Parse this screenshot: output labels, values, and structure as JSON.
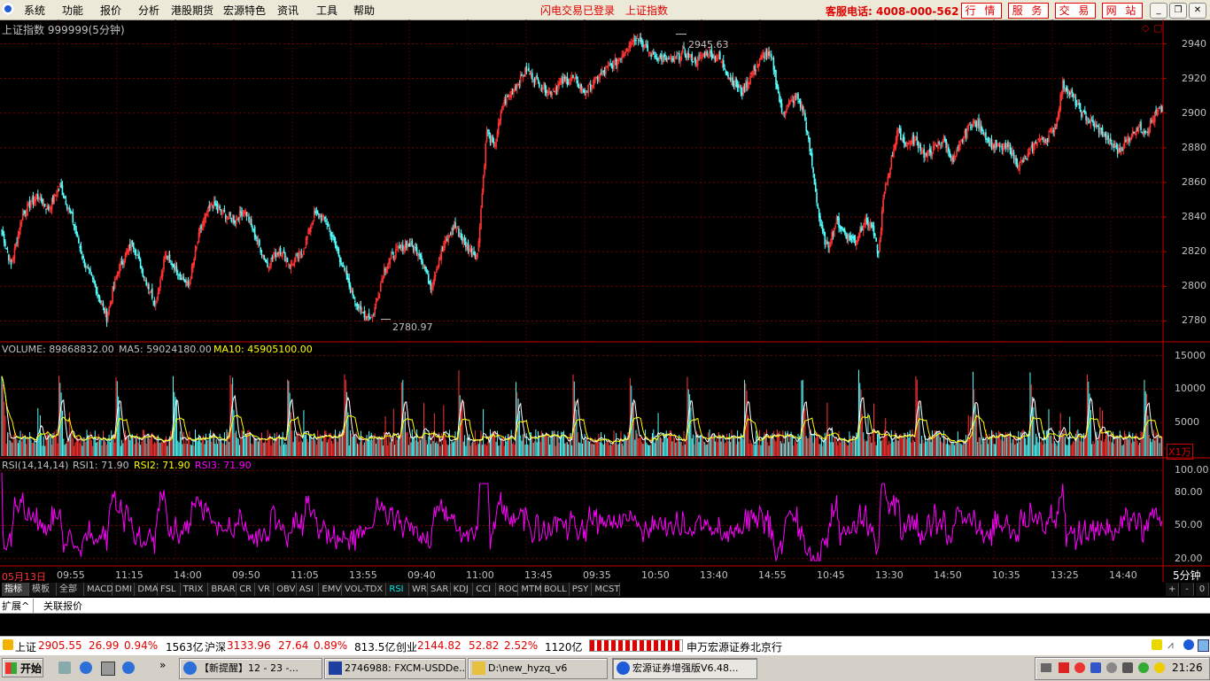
{
  "menu": [
    "系统",
    "功能",
    "报价",
    "分析",
    "港股期货",
    "宏源特色",
    "资讯",
    "工具",
    "帮助"
  ],
  "flash_left": "闪电交易已登录",
  "flash_right": "上证指数",
  "service_phone": "客服电话: 4008-000-562",
  "top_buttons": [
    "行 情",
    "服 务",
    "交 易",
    "网 站"
  ],
  "chart": {
    "title": "上证指数 999999(5分钟)",
    "high_label": "2945.63",
    "low_label": "2780.97",
    "period_label": "5分钟",
    "volume_unit": "X1万"
  },
  "volume_panel": {
    "volume": "VOLUME: 89868832.00",
    "ma5": "MA5: 59024180.00",
    "ma10": "MA10: 45905100.00"
  },
  "rsi_panel": {
    "name": "RSI(14,14,14)",
    "rsi1": "RSI1: 71.90",
    "rsi2": "RSI2: 71.90",
    "rsi3": "RSI3: 71.90"
  },
  "colors": {
    "up": "#ff3333",
    "down": "#54fcfc",
    "ma5": "#ffffff",
    "ma10": "#ffff00",
    "rsi": "#ff00ff",
    "grid": "#7a0000",
    "axis": "#c80000"
  },
  "chart_data": [
    {
      "type": "candlestick",
      "series_name": "上证指数",
      "ylim": [
        2770,
        2950
      ],
      "yticks": [
        2780,
        2800,
        2820,
        2840,
        2860,
        2880,
        2900,
        2920,
        2940
      ],
      "x_tick_labels": [
        "05月13日",
        "09:55",
        "11:15",
        "14:00",
        "09:50",
        "11:05",
        "13:55",
        "09:40",
        "11:00",
        "13:45",
        "09:35",
        "10:50",
        "13:40",
        "14:55",
        "10:45",
        "13:30",
        "14:50",
        "10:35",
        "13:25",
        "14:40"
      ],
      "keypoints": [
        [
          0,
          2832
        ],
        [
          8,
          2812
        ],
        [
          18,
          2842
        ],
        [
          30,
          2852
        ],
        [
          40,
          2845
        ],
        [
          50,
          2858
        ],
        [
          60,
          2840
        ],
        [
          70,
          2815
        ],
        [
          80,
          2800
        ],
        [
          90,
          2782
        ],
        [
          100,
          2810
        ],
        [
          112,
          2826
        ],
        [
          122,
          2806
        ],
        [
          132,
          2790
        ],
        [
          140,
          2818
        ],
        [
          150,
          2810
        ],
        [
          160,
          2800
        ],
        [
          170,
          2832
        ],
        [
          180,
          2848
        ],
        [
          190,
          2842
        ],
        [
          200,
          2838
        ],
        [
          208,
          2845
        ],
        [
          218,
          2828
        ],
        [
          228,
          2812
        ],
        [
          238,
          2822
        ],
        [
          248,
          2812
        ],
        [
          258,
          2820
        ],
        [
          268,
          2842
        ],
        [
          278,
          2838
        ],
        [
          288,
          2820
        ],
        [
          298,
          2800
        ],
        [
          308,
          2785
        ],
        [
          318,
          2782
        ],
        [
          328,
          2810
        ],
        [
          338,
          2820
        ],
        [
          348,
          2825
        ],
        [
          358,
          2820
        ],
        [
          368,
          2800
        ],
        [
          378,
          2822
        ],
        [
          388,
          2835
        ],
        [
          400,
          2822
        ],
        [
          408,
          2818
        ],
        [
          416,
          2890
        ],
        [
          422,
          2880
        ],
        [
          430,
          2905
        ],
        [
          440,
          2915
        ],
        [
          450,
          2925
        ],
        [
          460,
          2918
        ],
        [
          470,
          2912
        ],
        [
          480,
          2918
        ],
        [
          490,
          2920
        ],
        [
          500,
          2912
        ],
        [
          508,
          2918
        ],
        [
          518,
          2925
        ],
        [
          528,
          2930
        ],
        [
          538,
          2940
        ],
        [
          545,
          2945
        ],
        [
          555,
          2935
        ],
        [
          565,
          2932
        ],
        [
          575,
          2930
        ],
        [
          585,
          2935
        ],
        [
          595,
          2930
        ],
        [
          605,
          2935
        ],
        [
          615,
          2932
        ],
        [
          625,
          2920
        ],
        [
          635,
          2912
        ],
        [
          645,
          2925
        ],
        [
          655,
          2935
        ],
        [
          661,
          2930
        ],
        [
          669,
          2900
        ],
        [
          675,
          2905
        ],
        [
          682,
          2910
        ],
        [
          688,
          2900
        ],
        [
          695,
          2870
        ],
        [
          702,
          2835
        ],
        [
          708,
          2822
        ],
        [
          716,
          2838
        ],
        [
          724,
          2830
        ],
        [
          732,
          2826
        ],
        [
          740,
          2838
        ],
        [
          746,
          2835
        ],
        [
          752,
          2818
        ],
        [
          756,
          2850
        ],
        [
          762,
          2870
        ],
        [
          768,
          2890
        ],
        [
          776,
          2882
        ],
        [
          784,
          2885
        ],
        [
          792,
          2875
        ],
        [
          800,
          2880
        ],
        [
          808,
          2885
        ],
        [
          816,
          2872
        ],
        [
          824,
          2885
        ],
        [
          832,
          2895
        ],
        [
          840,
          2892
        ],
        [
          848,
          2882
        ],
        [
          856,
          2880
        ],
        [
          864,
          2880
        ],
        [
          872,
          2870
        ],
        [
          880,
          2875
        ],
        [
          888,
          2885
        ],
        [
          896,
          2885
        ],
        [
          904,
          2893
        ],
        [
          910,
          2917
        ],
        [
          918,
          2910
        ],
        [
          926,
          2900
        ],
        [
          934,
          2895
        ],
        [
          942,
          2890
        ],
        [
          950,
          2883
        ],
        [
          958,
          2878
        ],
        [
          966,
          2885
        ],
        [
          974,
          2892
        ],
        [
          982,
          2890
        ],
        [
          990,
          2900
        ],
        [
          995,
          2902
        ]
      ],
      "annotations": [
        {
          "text": "2945.63",
          "value": 2945.63
        },
        {
          "text": "2780.97",
          "value": 2780.97
        }
      ]
    },
    {
      "type": "bar",
      "series_name": "VOLUME",
      "ylim": [
        0,
        16000
      ],
      "yticks": [
        5000,
        10000,
        15000
      ],
      "unit": "X1万",
      "lines": [
        "MA5",
        "MA10"
      ]
    },
    {
      "type": "line",
      "series_name": "RSI(14,14,14)",
      "ylim": [
        15,
        105
      ],
      "yticks": [
        20,
        50,
        80,
        100
      ],
      "ytick_labels": [
        "20.00",
        "50.00",
        "80.00",
        "100.00"
      ],
      "series": [
        {
          "name": "RSI1",
          "last": 71.9
        },
        {
          "name": "RSI2",
          "last": 71.9
        },
        {
          "name": "RSI3",
          "last": 71.9
        }
      ]
    }
  ],
  "indicator_tabs": [
    "指标",
    "模板",
    "全部",
    "MACD",
    "DMI",
    "DMA",
    "FSL",
    "TRIX",
    "BRAR",
    "CR",
    "VR",
    "OBV",
    "ASI",
    "EMV",
    "VOL-TDX",
    "RSI",
    "WR",
    "SAR",
    "KDJ",
    "CCI",
    "ROC",
    "MTM",
    "BOLL",
    "PSY",
    "MCST"
  ],
  "selected_tab": "RSI",
  "ext_tabs": [
    "扩展^",
    "关联报价"
  ],
  "zoom_buttons": [
    "+",
    "-",
    "0"
  ],
  "status": {
    "sh_label": "上证",
    "sh_value": "2905.55",
    "sh_change": "26.99",
    "sh_pct": "0.94%",
    "sh_amount": "1563亿",
    "hs_label": "沪深",
    "hs_value": "3133.96",
    "hs_change": "27.64",
    "hs_pct": "0.89%",
    "hs_amount": "813.5亿",
    "cy_label": "创业",
    "cy_value": "2144.82",
    "cy_change": "52.82",
    "cy_pct": "2.52%",
    "cy_amount": "1120亿",
    "broker": "申万宏源证券北京行"
  },
  "taskbar": {
    "start": "开始",
    "items": [
      "【新提醒】12 - 23 -...",
      "2746988: FXCM-USDDe...",
      "D:\\new_hyzq_v6",
      "宏源证券增强版V6.48..."
    ],
    "clock": "21:26"
  }
}
